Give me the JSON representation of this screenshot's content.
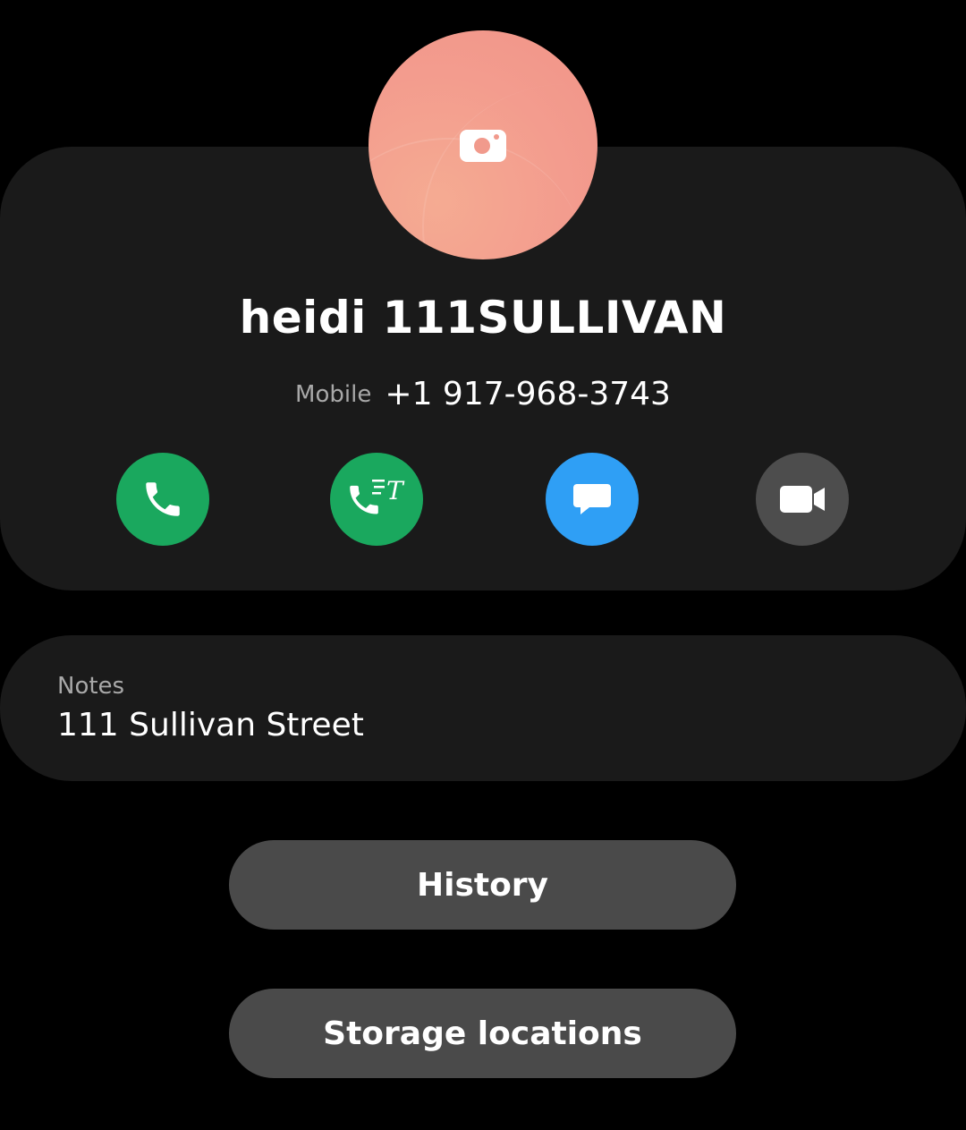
{
  "contact": {
    "name": "heidi 111SULLIVAN",
    "phone_type": "Mobile",
    "phone_number": "+1 917-968-3743",
    "avatar_icon": "camera-icon",
    "avatar_color": "#f39c8e"
  },
  "actions": [
    {
      "icon": "phone-icon",
      "color": "#1aa85e"
    },
    {
      "icon": "rtt-call-icon",
      "color": "#1aa85e"
    },
    {
      "icon": "message-icon",
      "color": "#2f9ff5"
    },
    {
      "icon": "video-call-icon",
      "color": "#4d4d4d"
    }
  ],
  "notes": {
    "label": "Notes",
    "value": "111 Sullivan Street"
  },
  "buttons": {
    "history": "History",
    "storage_locations": "Storage locations"
  }
}
